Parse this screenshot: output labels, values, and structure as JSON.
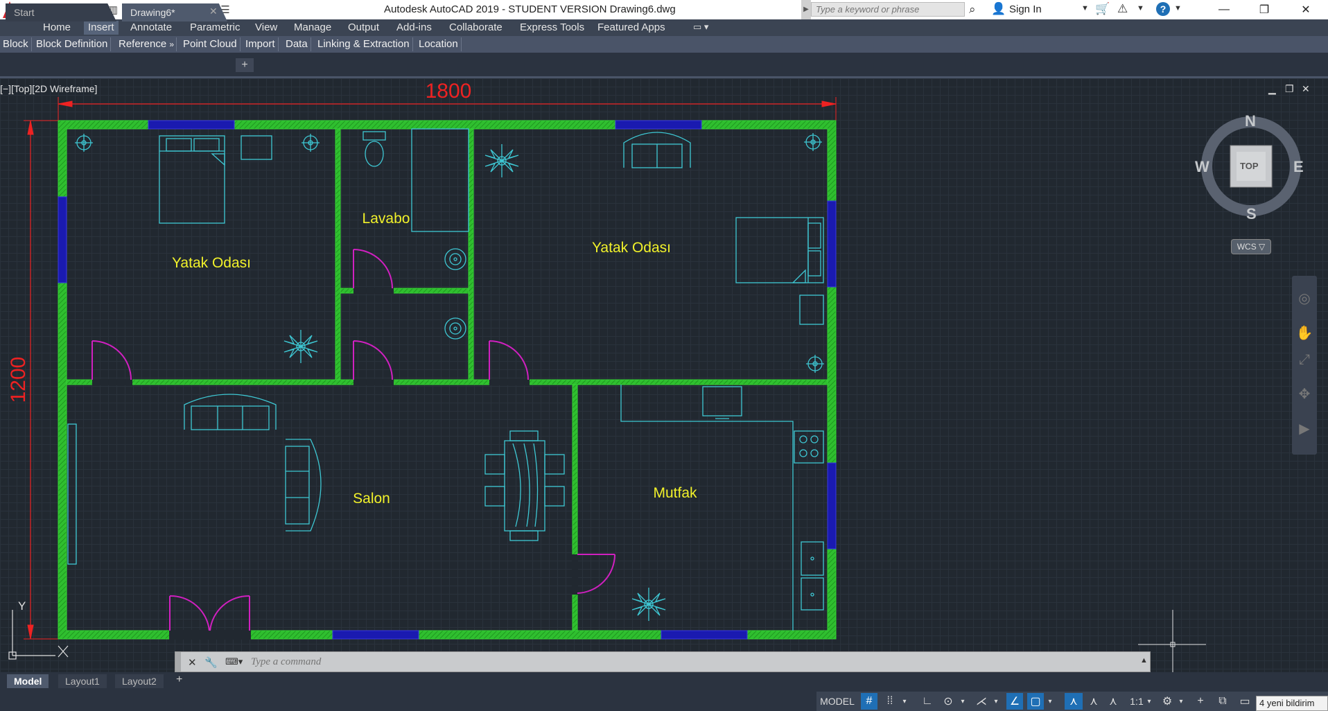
{
  "titlebar": {
    "app_logo": "A",
    "title": "Autodesk AutoCAD 2019 - STUDENT VERSION    Drawing6.dwg",
    "search_placeholder": "Type a keyword or phrase",
    "sign_in": "Sign In",
    "quick_access_icons": [
      "new-icon",
      "open-icon",
      "save-icon",
      "save-as-icon",
      "open-web-icon",
      "save-web-icon",
      "plot-icon",
      "undo-icon",
      "redo-icon",
      "customize-icon"
    ]
  },
  "ribbon_tabs": [
    {
      "label": "Home",
      "active": false
    },
    {
      "label": "Insert",
      "active": true
    },
    {
      "label": "Annotate",
      "active": false
    },
    {
      "label": "Parametric",
      "active": false
    },
    {
      "label": "View",
      "active": false
    },
    {
      "label": "Manage",
      "active": false
    },
    {
      "label": "Output",
      "active": false
    },
    {
      "label": "Add-ins",
      "active": false
    },
    {
      "label": "Collaborate",
      "active": false
    },
    {
      "label": "Express Tools",
      "active": false
    },
    {
      "label": "Featured Apps",
      "active": false
    }
  ],
  "ribbon_panels": [
    "Block",
    "Block Definition",
    "Reference",
    "Point Cloud",
    "Import",
    "Data",
    "Linking & Extraction",
    "Location"
  ],
  "reference_arrow": "»",
  "doc_tabs": {
    "start": "Start",
    "drawing": "Drawing6*"
  },
  "viewport": {
    "label": "[−][Top][2D Wireframe]",
    "dim_width": "1800",
    "dim_height": "1200",
    "rooms": {
      "bedroom_left": "Yatak Odası",
      "toilet": "Lavabo",
      "bedroom_right": "Yatak Odası",
      "living": "Salon",
      "kitchen": "Mutfak"
    },
    "ucs_y": "Y",
    "ucs_x": "X"
  },
  "viewcube": {
    "north": "N",
    "south": "S",
    "east": "E",
    "west": "W",
    "face": "TOP",
    "wcs": "WCS ▽"
  },
  "command_line": {
    "placeholder": "Type a command"
  },
  "layout_tabs": [
    {
      "label": "Model",
      "active": true
    },
    {
      "label": "Layout1",
      "active": false
    },
    {
      "label": "Layout2",
      "active": false
    }
  ],
  "status": {
    "model": "MODEL",
    "scale": "1:1",
    "notification": "4 yeni bildirim"
  },
  "colors": {
    "wall": "#35d435",
    "window": "#1a1ab0",
    "door": "#d020c0",
    "furniture": "#3ec8d4",
    "room_text": "#f2f22a",
    "dimension": "#ee2222"
  }
}
